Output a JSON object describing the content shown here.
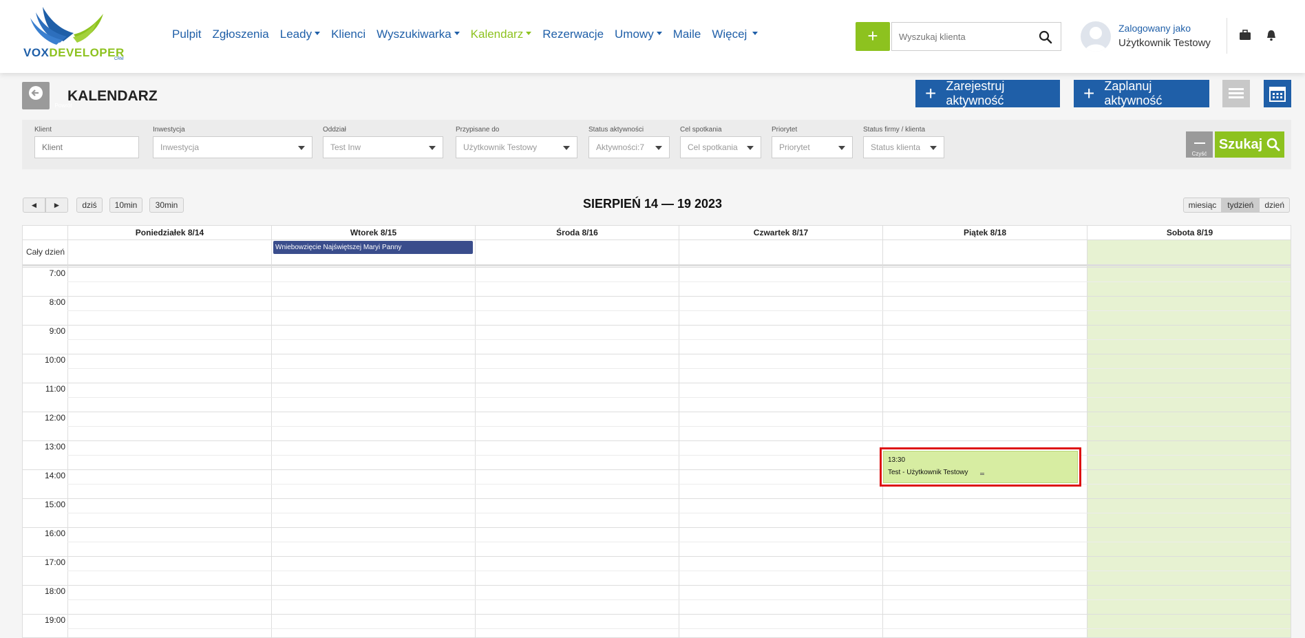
{
  "logo": {
    "part1": "VOX",
    "part2": "DEVELOPER",
    "suffix": "CRM"
  },
  "nav": {
    "items": [
      {
        "label": "Pulpit",
        "dropdown": false,
        "active": false
      },
      {
        "label": "Zgłoszenia",
        "dropdown": false,
        "active": false
      },
      {
        "label": "Leady",
        "dropdown": true,
        "active": false
      },
      {
        "label": "Klienci",
        "dropdown": false,
        "active": false
      },
      {
        "label": "Wyszukiwarka",
        "dropdown": true,
        "active": false
      },
      {
        "label": "Kalendarz",
        "dropdown": true,
        "active": true
      },
      {
        "label": "Rezerwacje",
        "dropdown": false,
        "active": false
      },
      {
        "label": "Umowy",
        "dropdown": true,
        "active": false
      },
      {
        "label": "Maile",
        "dropdown": false,
        "active": false
      },
      {
        "label": "Więcej",
        "dropdown": true,
        "active": false
      }
    ]
  },
  "header": {
    "add_label": "+",
    "search_placeholder": "Wyszukaj klienta",
    "logged_as": "Zalogowany jako",
    "user_name": "Użytkownik Testowy"
  },
  "page": {
    "back_label": "Powrót",
    "title": "KALENDARZ",
    "register_label": "Zarejestruj aktywność",
    "plan_label": "Zaplanuj aktywność"
  },
  "filters": {
    "klient": {
      "label": "Klient",
      "placeholder": "Klient"
    },
    "inwestycja": {
      "label": "Inwestycja",
      "value": "Inwestycja"
    },
    "oddzial": {
      "label": "Oddział",
      "value": "Test Inw"
    },
    "przypisane": {
      "label": "Przypisane do",
      "value": "Użytkownik Testowy"
    },
    "status_akt": {
      "label": "Status aktywności",
      "value": "Aktywności:7"
    },
    "cel": {
      "label": "Cel spotkania",
      "value": "Cel spotkania"
    },
    "priorytet": {
      "label": "Priorytet",
      "value": "Priorytet"
    },
    "status_firmy": {
      "label": "Status firmy / klienta",
      "value": "Status klienta"
    },
    "clear_label": "Czyść",
    "search_label": "Szukaj"
  },
  "toolbar": {
    "prev": "◄",
    "next": "►",
    "today": "dziś",
    "min10": "10min",
    "min30": "30min",
    "title": "SIERPIEŃ 14 — 19 2023",
    "views": [
      {
        "label": "miesiąc",
        "active": false
      },
      {
        "label": "tydzień",
        "active": true
      },
      {
        "label": "dzień",
        "active": false
      }
    ]
  },
  "calendar": {
    "days": [
      "Poniedziałek 8/14",
      "Wtorek 8/15",
      "Środa 8/16",
      "Czwartek 8/17",
      "Piątek 8/18",
      "Sobota 8/19"
    ],
    "allday_label": "Cały dzień",
    "hours": [
      "7:00",
      "8:00",
      "9:00",
      "10:00",
      "11:00",
      "12:00",
      "13:00",
      "14:00",
      "15:00",
      "16:00",
      "17:00",
      "18:00",
      "19:00"
    ],
    "allday_event": "Wniebowzięcie Najświętszej Maryi Panny",
    "event": {
      "time": "13:30",
      "title": "Test - Użytkownik Testowy"
    }
  }
}
